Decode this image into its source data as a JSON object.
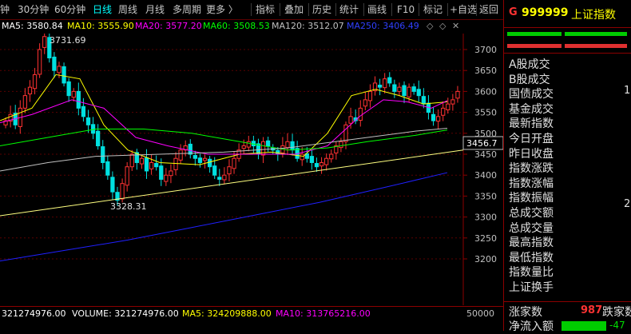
{
  "toolbar": {
    "items": [
      {
        "label": "钟",
        "active": false
      },
      {
        "label": "30分钟",
        "active": false
      },
      {
        "label": "60分钟",
        "active": false
      },
      {
        "label": "日线",
        "active": true
      },
      {
        "label": "周线",
        "active": false
      },
      {
        "label": "月线",
        "active": false
      },
      {
        "label": "多周期",
        "active": false
      },
      {
        "label": "更多 〉",
        "active": false
      }
    ],
    "right_items": [
      "指标",
      "叠加",
      "历史",
      "统计",
      "画线",
      "F10",
      "标记",
      "+自选",
      "返回"
    ]
  },
  "ma_line": {
    "ma5": "MA5: 3580.84",
    "ma10": "MA10: 3555.90",
    "ma20": "MA20: 3577.20",
    "ma60": "MA60: 3508.53",
    "ma120": "MA120: 3512.07",
    "ma250": "MA250: 3406.49"
  },
  "chart": {
    "y_ticks": [
      "3700",
      "3650",
      "3600",
      "3550",
      "3500",
      "3450",
      "3400",
      "3350",
      "3300",
      "3250",
      "3200"
    ],
    "high_label": "3731.69",
    "low_label": "3328.31",
    "current_marker": "3456.7",
    "vol_axis_label": "50000",
    "colors": {
      "up": "#ff3232",
      "down": "#00e0e0",
      "ma5": "#ffffff",
      "ma10": "#ffff00",
      "ma20": "#ff00ff",
      "ma60": "#00ff00",
      "ma120": "#c0c0c0",
      "ma250": "#2020ff",
      "trend": "#ffff80"
    }
  },
  "vol_line": {
    "v0": "321274976.00",
    "volume": "VOLUME: 321274976.00",
    "ma5": "MA5: 324209888.00",
    "ma10": "MA10: 313765216.00"
  },
  "panel": {
    "prefix": "G",
    "code": "999999",
    "name": "上证指数",
    "labels": [
      "A股成交",
      "B股成交",
      "国债成交",
      "基金成交",
      "最新指数",
      "今日开盘",
      "昨日收盘",
      "指数涨跌",
      "指数涨幅",
      "指数振幅",
      "总成交额",
      "总成交量",
      "最高指数",
      "最低指数",
      "指数量比",
      "上证换手"
    ],
    "zhangjia_label": "涨家数",
    "zhangjia_value": "987",
    "diejia_label": "跌家数",
    "jingliu_label": "净流入额",
    "jingliu_value": "-47"
  }
}
